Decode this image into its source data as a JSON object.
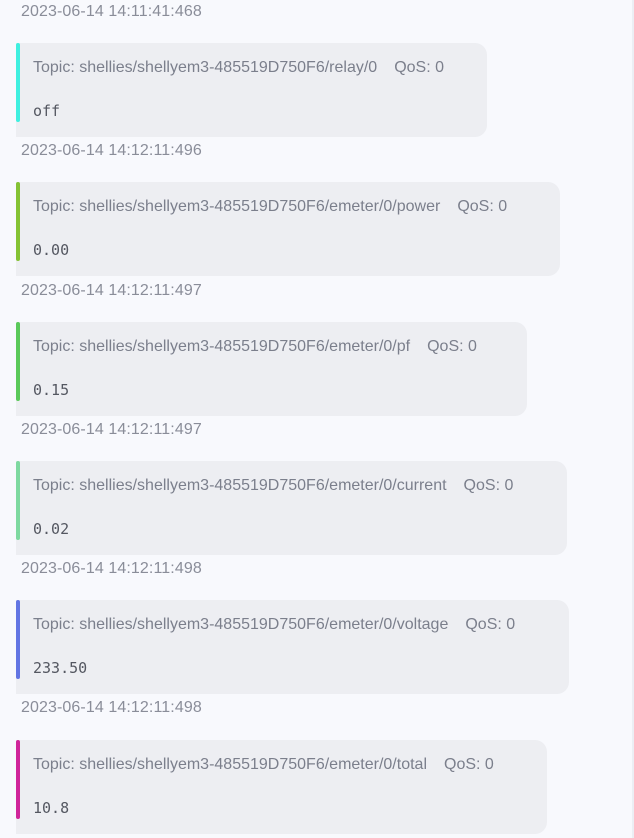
{
  "timestamps": [
    "2023-06-14 14:11:41:468",
    "2023-06-14 14:12:11:496",
    "2023-06-14 14:12:11:497",
    "2023-06-14 14:12:11:497",
    "2023-06-14 14:12:11:498",
    "2023-06-14 14:12:11:498"
  ],
  "messages": [
    {
      "topic": "Topic: shellies/shellyem3-485519D750F6/relay/0",
      "qos": "QoS: 0",
      "payload": "off",
      "color": "#3ff0e0"
    },
    {
      "topic": "Topic: shellies/shellyem3-485519D750F6/emeter/0/power",
      "qos": "QoS: 0",
      "payload": "0.00",
      "color": "#84c234"
    },
    {
      "topic": "Topic: shellies/shellyem3-485519D750F6/emeter/0/pf",
      "qos": "QoS: 0",
      "payload": "0.15",
      "color": "#5ac95a"
    },
    {
      "topic": "Topic: shellies/shellyem3-485519D750F6/emeter/0/current",
      "qos": "QoS: 0",
      "payload": "0.02",
      "color": "#7ed9a0"
    },
    {
      "topic": "Topic: shellies/shellyem3-485519D750F6/emeter/0/voltage",
      "qos": "QoS: 0",
      "payload": "233.50",
      "color": "#6275e3"
    },
    {
      "topic": "Topic: shellies/shellyem3-485519D750F6/emeter/0/total",
      "qos": "QoS: 0",
      "payload": "10.8",
      "color": "#d0259a"
    }
  ]
}
